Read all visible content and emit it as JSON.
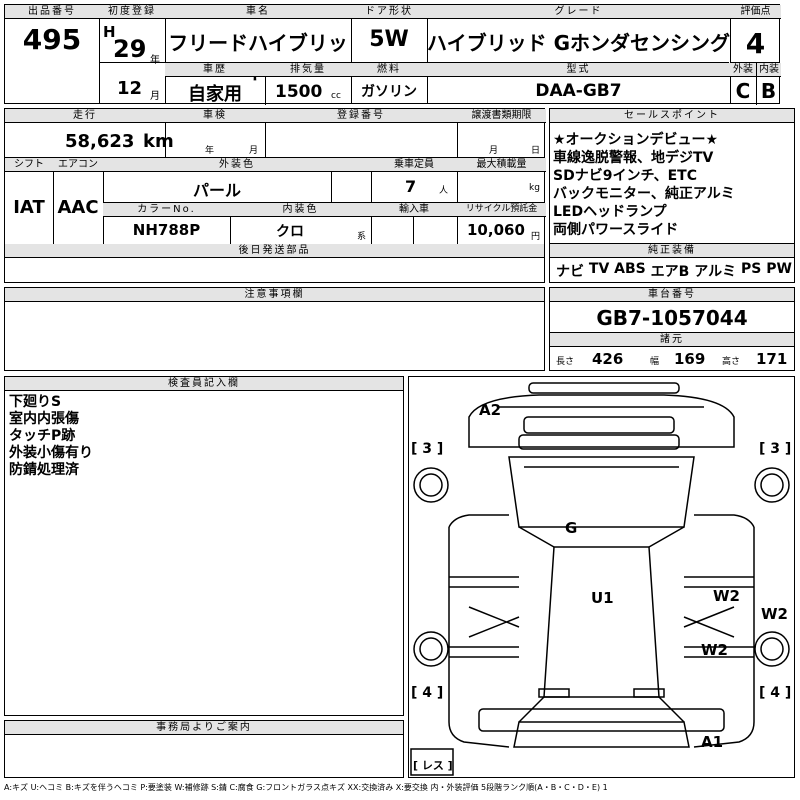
{
  "header": {
    "lot_label": "出品番号",
    "lot_no": "495",
    "first_reg_label": "初度登録",
    "era": "H",
    "year": "29",
    "year_unit": "年",
    "month": "12",
    "month_unit": "月",
    "name_label": "車名",
    "car_name": "フリードハイブリッド",
    "door_label": "ドア形状",
    "door": "5W",
    "grade_label": "グレード",
    "grade": "ハイブリッド Gホンダセンシング",
    "score_label": "評価点",
    "score": "4",
    "history_label": "車歴",
    "history": "自家用",
    "disp_label": "排気量",
    "displacement": "1500",
    "disp_unit": "cc",
    "fuel_label": "燃料",
    "fuel": "ガソリン",
    "model_label": "型式",
    "model": "DAA-GB7",
    "ext_label": "外装",
    "ext_grade": "C",
    "int_label": "内装",
    "int_grade": "B"
  },
  "row2": {
    "mileage_label": "走行",
    "mileage": "58,623",
    "mileage_unit": "km",
    "inspection_label": "車検",
    "insp_year_unit": "年",
    "insp_month_unit": "月",
    "reg_label": "登録番号",
    "deadline_label": "譲渡書類期限",
    "dl_month_unit": "月",
    "dl_day_unit": "日",
    "shift_label": "シフト",
    "shift": "IAT",
    "ac_label": "エアコン",
    "ac": "AAC",
    "color_label": "外装色",
    "color": "パール",
    "capacity_label": "乗車定員",
    "capacity": "7",
    "capacity_unit": "人",
    "load_label": "最大積載量",
    "load_unit": "kg",
    "color_no_label": "カラーNo.",
    "color_no": "NH788P",
    "interior_label": "内装色",
    "interior": "クロ",
    "interior_unit": "系",
    "import_label": "輸入車",
    "recycle_label": "リサイクル預託金",
    "recycle": "10,060",
    "recycle_unit": "円",
    "later_label": "後日発送部品"
  },
  "sales": {
    "label": "セールスポイント",
    "lines": [
      "★オークションデビュー★",
      "車線逸脱警報、地デジTV",
      "SDナビ9インチ、ETC",
      "バックモニター、純正アルミ",
      "LEDヘッドランプ",
      "両側パワースライド"
    ]
  },
  "equipment": {
    "label": "純正装備",
    "items": [
      "ナビ",
      "TV",
      "ABS",
      "エアB",
      "アルミ",
      "PS",
      "PW"
    ]
  },
  "notes": {
    "label": "注意事項欄"
  },
  "chassis": {
    "label": "車台番号",
    "number": "GB7-1057044",
    "spec_label": "諸元",
    "len_label": "長さ",
    "length": "426",
    "wid_label": "幅",
    "width": "169",
    "hgt_label": "高さ",
    "height": "171"
  },
  "inspector": {
    "label": "検査員記入欄",
    "lines": [
      "下廻りS",
      "室内内張傷",
      "タッチP跡",
      "外装小傷有り",
      "防錆処理済"
    ]
  },
  "diagram": {
    "marks": {
      "a2": "A2",
      "g": "G",
      "u1": "U1",
      "w2a": "W2",
      "w2b": "W2",
      "w2c": "W2",
      "a1": "A1"
    },
    "tires": {
      "fl": "[ 3 ]",
      "fr": "[ 3 ]",
      "rl": "[ 4 ]",
      "rr": "[ 4 ]",
      "spare": "[ レス ]"
    }
  },
  "office": {
    "label": "事務局よりご案内"
  },
  "legend": "A:キズ U:ヘコミ B:キズを伴うヘコミ P:要塗装 W:補修跡 S:錆 C:腐食 G:フロントガラス点キズ XX:交換済み X:要交換 内・外装評価 5段階ランク順(A・B・C・D・E) 1"
}
